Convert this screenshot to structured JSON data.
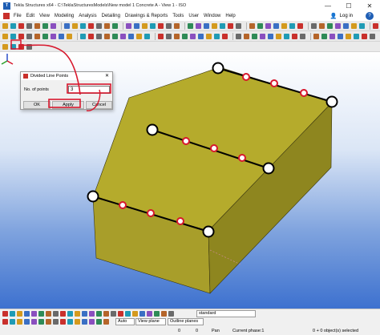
{
  "app": {
    "title": "Tekla Structures x64 - C:\\TeklaStructuresModels\\New model 1 Concrete A - View 1 - ISO",
    "logo_text": "T",
    "window_controls": [
      "—",
      "☐",
      "✕"
    ]
  },
  "menu": {
    "items": [
      "File",
      "Edit",
      "View",
      "Modeling",
      "Analysis",
      "Detailing",
      "Drawings & Reports",
      "Tools",
      "User",
      "Window",
      "Help"
    ],
    "login_label": "Log in",
    "help_label": "?"
  },
  "dialog": {
    "title": "Divided Line Points",
    "close": "✕",
    "field_label": "No. of points",
    "field_value": "3",
    "ok_label": "OK",
    "apply_label": "Apply",
    "cancel_label": "Cancel"
  },
  "bottom_bar": {
    "standard_value": "standard",
    "select_mode": "Auto",
    "view_plane": "View plane",
    "outline_planes": "Outline planes",
    "coord_x": "0",
    "coord_y": "0",
    "pan_label": "Pan",
    "current_phase": "Current phase:1",
    "selected_status": "0 + 0 object(s) selected"
  },
  "colors": {
    "viewport_top": "#ffffff",
    "viewport_bottom": "#3d71cf",
    "box_face_top": "#b5ab2c",
    "box_face_front": "#a89e2a",
    "box_face_side": "#8e861f",
    "annotation_red": "#d8182d"
  },
  "icons": [
    "tekla-logo-icon",
    "user-icon",
    "help-icon",
    "close-icon",
    "axis-gizmo-icon"
  ]
}
